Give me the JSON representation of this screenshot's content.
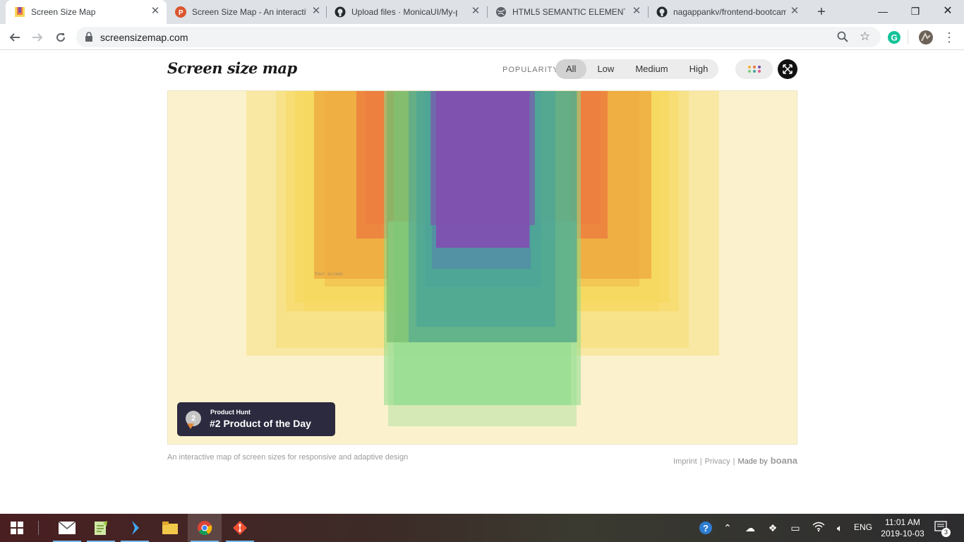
{
  "browser": {
    "tabs": [
      {
        "title": "Screen Size Map",
        "active": true
      },
      {
        "title": "Screen Size Map - An interactive",
        "active": false
      },
      {
        "title": "Upload files · MonicaUI/My-pro",
        "active": false
      },
      {
        "title": "HTML5 SEMANTIC ELEMENT",
        "active": false
      },
      {
        "title": "nagappankv/frontend-bootcamp",
        "active": false
      }
    ],
    "url": "screensizemap.com"
  },
  "page": {
    "logo": "Screen size map",
    "popularity_label": "POPULARITY",
    "filters": [
      "All",
      "Low",
      "Medium",
      "High"
    ],
    "active_filter": "All",
    "your_screen_label": "Your screen",
    "badge": {
      "small": "Product Hunt",
      "big": "#2 Product of the Day",
      "medal": "2"
    },
    "tagline": "An interactive map of screen sizes for responsive and adaptive design",
    "footer": {
      "imprint": "Imprint",
      "privacy": "Privacy",
      "made_by": "Made by",
      "brand": "boana"
    }
  },
  "colors": {
    "map_bg": "#fbf2cd",
    "yellow": "#f6d75a",
    "orange": "#eea73e",
    "red_orange": "#ec7a3f",
    "green": "#7ccf7c",
    "teal": "#4aa39a",
    "purple": "#8051b0"
  },
  "taskbar": {
    "apps": [
      "start-icon",
      "mail-icon",
      "notepad-plus-icon",
      "vscode-icon",
      "file-explorer-icon",
      "chrome-icon",
      "git-icon"
    ],
    "language": "ENG",
    "time": "11:01 AM",
    "date": "2019-10-03",
    "notifications": "3"
  }
}
